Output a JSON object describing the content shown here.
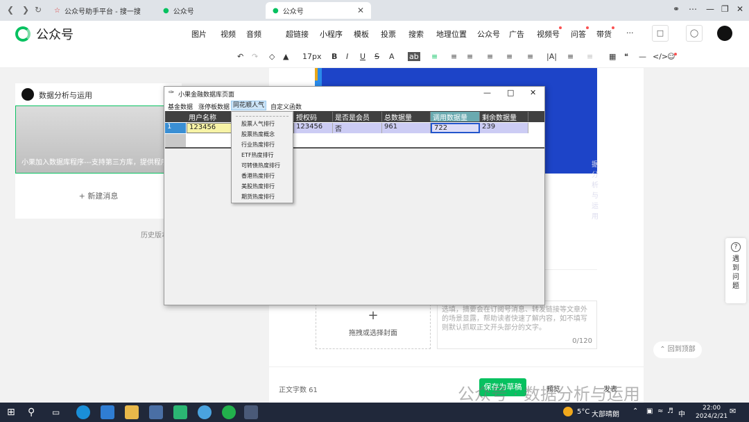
{
  "browser": {
    "tabs": [
      {
        "label": "公众号助手平台 - 搜一搜"
      },
      {
        "label": "公众号"
      },
      {
        "label": "公众号"
      }
    ]
  },
  "header": {
    "logo_text": "公众号",
    "menu": [
      "图片",
      "视频",
      "音频",
      "超链接",
      "小程序",
      "模板",
      "投票",
      "搜索",
      "地理位置",
      "公众号",
      "广告",
      "视频号",
      "问答",
      "带货"
    ],
    "more": "···"
  },
  "toolbar": {
    "font_size": "17px"
  },
  "left_panel": {
    "account_name": "数据分析与运用",
    "card_text": "小果加入数据库程序---支持第三方库，提供程序",
    "new_message": "新建消息",
    "history": "历史版本"
  },
  "center": {
    "image_caption": "据分析与运用",
    "cover_label": "拖拽或选择封面",
    "cover_plus": "+",
    "summary_placeholder": "选填，摘要会在订阅号消息、转发链接等文章外的场景显露，帮助读者快速了解内容，如不填写则默认抓取正文开头部分的文字。",
    "summary_count": "0/120",
    "word_count": "正文字数 61",
    "save_button": "保存为草稿",
    "preview_button": "预览",
    "publish_button": "发表"
  },
  "side": {
    "help_label": [
      "遇",
      "到",
      "问",
      "题"
    ],
    "back_top": "回到顶部"
  },
  "watermark": "公众号 · 数据分析与运用",
  "app_window": {
    "title": "小果金融数据库页面",
    "menu": [
      "基金数据",
      "涨停板数据",
      "同花顺人气",
      "自定义函数"
    ],
    "active_menu": "同花顺人气",
    "columns": [
      "用户名称",
      "授权码",
      "是否是会员",
      "总数据量",
      "调用数据量",
      "剩余数据量"
    ],
    "row": {
      "index": "1",
      "cells": [
        "123456",
        "123456",
        "否",
        "961",
        "722",
        "239"
      ]
    },
    "dropdown_items": [
      "股票人气排行",
      "股票热度概念",
      "行业热度排行",
      "ETF热度排行",
      "可转债热度排行",
      "香港热度排行",
      "美股热度排行",
      "期货热度排行"
    ]
  },
  "taskbar": {
    "temperature": "5°C",
    "weather": "大部晴朗",
    "language": "中",
    "time": "22:00",
    "date": "2024/2/21"
  }
}
